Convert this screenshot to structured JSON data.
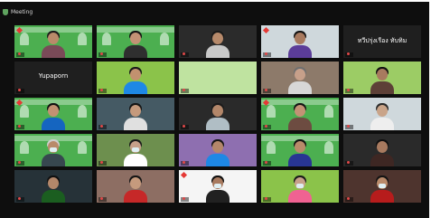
{
  "app": {
    "meeting_label": "Meeting"
  },
  "colors": {
    "background": "#0e0e0e",
    "green_banner": "#4caf50",
    "mic_muted": "#e04848",
    "heart": "#e53935"
  },
  "participants": [
    {
      "name": "",
      "bg": "#4caf50",
      "type": "person",
      "heart": true,
      "banner": true,
      "shirt": "#7a4a58",
      "skin": "#b98a6a",
      "hair": "#1b1b1b"
    },
    {
      "name": "",
      "bg": "#4caf50",
      "type": "person",
      "heart": false,
      "banner": true,
      "shirt": "#2f2f2f",
      "skin": "#c39275",
      "hair": "#141414"
    },
    {
      "name": "",
      "bg": "#2b2b2b",
      "type": "person",
      "heart": false,
      "banner": false,
      "shirt": "#c8c8c8",
      "skin": "#b78a6b",
      "hair": "#1a1a1a"
    },
    {
      "name": "",
      "bg": "#cfd8dc",
      "type": "person",
      "heart": true,
      "banner": false,
      "shirt": "#5b3d99",
      "skin": "#a87a5f",
      "hair": "#121212"
    },
    {
      "name": "",
      "bg": "#1f1f1f",
      "type": "text",
      "heart": false,
      "banner": false,
      "center": "ทวีปรุ่งเรือง ทับทิม"
    },
    {
      "name": "",
      "bg": "#1f1f1f",
      "type": "text",
      "heart": false,
      "banner": false,
      "center": "Yupaporn"
    },
    {
      "name": "",
      "bg": "#8bc34a",
      "type": "person",
      "heart": false,
      "banner": false,
      "shirt": "#1e88e5",
      "skin": "#c2916f",
      "hair": "#1a1a1a",
      "mask": false
    },
    {
      "name": "",
      "bg": "#bfe3a0",
      "type": "blank",
      "heart": false,
      "banner": false
    },
    {
      "name": "",
      "bg": "#8d7a6a",
      "type": "person",
      "heart": false,
      "banner": false,
      "shirt": "#d7d7d7",
      "skin": "#c7a08a",
      "hair": "#6f6f6f"
    },
    {
      "name": "",
      "bg": "#9ccc65",
      "type": "person",
      "heart": false,
      "banner": false,
      "shirt": "#5d4037",
      "skin": "#a87a5f",
      "hair": "#101010"
    },
    {
      "name": "",
      "bg": "#4caf50",
      "type": "person",
      "heart": true,
      "banner": true,
      "shirt": "#1565c0",
      "skin": "#c29172",
      "hair": "#111111"
    },
    {
      "name": "",
      "bg": "#455a64",
      "type": "person",
      "heart": false,
      "banner": false,
      "shirt": "#e0e0e0",
      "skin": "#c59a7d",
      "hair": "#151515"
    },
    {
      "name": "",
      "bg": "#2a2a2a",
      "type": "person",
      "heart": false,
      "banner": false,
      "shirt": "#b0bec5",
      "skin": "#b3876a",
      "hair": "#1b1b1b"
    },
    {
      "name": "",
      "bg": "#4caf50",
      "type": "person",
      "heart": true,
      "banner": true,
      "shirt": "#6d4c41",
      "skin": "#c39275",
      "hair": "#151515"
    },
    {
      "name": "",
      "bg": "#cfd8dc",
      "type": "person",
      "heart": false,
      "banner": false,
      "shirt": "#eeeeee",
      "skin": "#c9a489",
      "hair": "#2b2b2b"
    },
    {
      "name": "",
      "bg": "#4caf50",
      "type": "person",
      "heart": false,
      "banner": true,
      "shirt": "#37474f",
      "skin": "#b98a6a",
      "hair": "#cfcfcf",
      "mask": true
    },
    {
      "name": "",
      "bg": "#6d8f4e",
      "type": "person",
      "heart": false,
      "banner": false,
      "shirt": "#ffffff",
      "skin": "#c7a08a",
      "hair": "#1a1a1a",
      "mask": true
    },
    {
      "name": "",
      "bg": "#8e6fb0",
      "type": "person",
      "heart": false,
      "banner": false,
      "shirt": "#1e88e5",
      "skin": "#b3876a",
      "hair": "#151515"
    },
    {
      "name": "",
      "bg": "#4caf50",
      "type": "person",
      "heart": false,
      "banner": true,
      "shirt": "#283593",
      "skin": "#b98a6a",
      "hair": "#111111"
    },
    {
      "name": "",
      "bg": "#2a2a2a",
      "type": "person",
      "heart": false,
      "banner": false,
      "shirt": "#3e2723",
      "skin": "#a87a5f",
      "hair": "#101010"
    },
    {
      "name": "",
      "bg": "#263238",
      "type": "person",
      "heart": false,
      "banner": false,
      "shirt": "#1b5e20",
      "skin": "#b3876a",
      "hair": "#111111"
    },
    {
      "name": "",
      "bg": "#8d6e63",
      "type": "person",
      "heart": false,
      "banner": false,
      "shirt": "#c62828",
      "skin": "#c59a7d",
      "hair": "#151515"
    },
    {
      "name": "",
      "bg": "#f5f5f5",
      "type": "person",
      "heart": true,
      "banner": false,
      "shirt": "#212121",
      "skin": "#a87a5f",
      "hair": "#0f0f0f",
      "mask": true
    },
    {
      "name": "",
      "bg": "#8bc34a",
      "type": "person",
      "heart": false,
      "banner": false,
      "shirt": "#f06292",
      "skin": "#c7a08a",
      "hair": "#1a1a1a",
      "mask": true
    },
    {
      "name": "",
      "bg": "#4e342e",
      "type": "person",
      "heart": false,
      "banner": false,
      "shirt": "#b71c1c",
      "skin": "#b98a6a",
      "hair": "#141414",
      "mask": true
    }
  ]
}
